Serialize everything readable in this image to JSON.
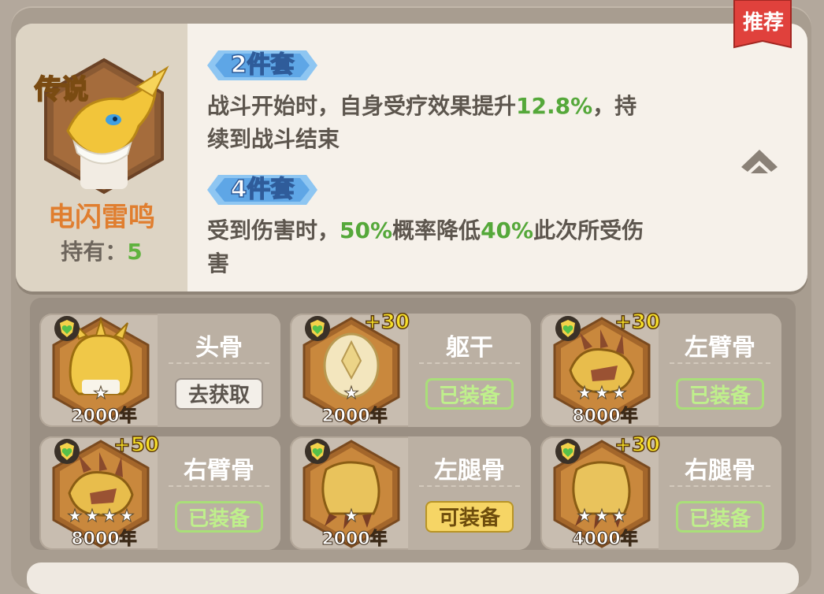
{
  "set": {
    "rarity": "传说",
    "name": "电闪雷鸣",
    "owned_label": "持有：",
    "owned_count": "5",
    "recommend": "推荐",
    "bonus2": {
      "tag": "2件套",
      "line1_a": "战斗开始时，自身受疗效果提升",
      "line1_hl": "12.8%",
      "line1_b": "，持",
      "line2": "续到战斗结束"
    },
    "bonus4": {
      "tag": "4件套",
      "line1_a": "受到伤害时，",
      "line1_hl1": "50%",
      "line1_b": "概率降低",
      "line1_hl2": "40%",
      "line1_c": "此次所受伤",
      "line2": "害"
    }
  },
  "items": [
    {
      "name": "头骨",
      "years": "2000年",
      "plus": "",
      "stars": 1,
      "button": "去获取",
      "state": "get",
      "icon": "skull-bone-icon"
    },
    {
      "name": "躯干",
      "years": "2000年",
      "plus": "+30",
      "stars": 1,
      "button": "已装备",
      "state": "equipped",
      "icon": "torso-bone-icon"
    },
    {
      "name": "左臂骨",
      "years": "8000年",
      "plus": "+30",
      "stars": 3,
      "button": "已装备",
      "state": "equipped",
      "icon": "claw-bone-icon"
    },
    {
      "name": "右臂骨",
      "years": "8000年",
      "plus": "+50",
      "stars": 4,
      "button": "已装备",
      "state": "equipped",
      "icon": "claw-bone-icon"
    },
    {
      "name": "左腿骨",
      "years": "2000年",
      "plus": "",
      "stars": 1,
      "button": "可装备",
      "state": "equippable",
      "icon": "leg-bone-icon"
    },
    {
      "name": "右腿骨",
      "years": "4000年",
      "plus": "+30",
      "stars": 3,
      "button": "已装备",
      "state": "equipped",
      "icon": "leg-bone-icon"
    }
  ],
  "colors": {
    "highlight_green": "#55a83a",
    "rarity_gold": "#f5c21a",
    "set_name_orange": "#e07e2f",
    "equipped_green": "#a9df79",
    "recommend_red": "#e0413c"
  }
}
